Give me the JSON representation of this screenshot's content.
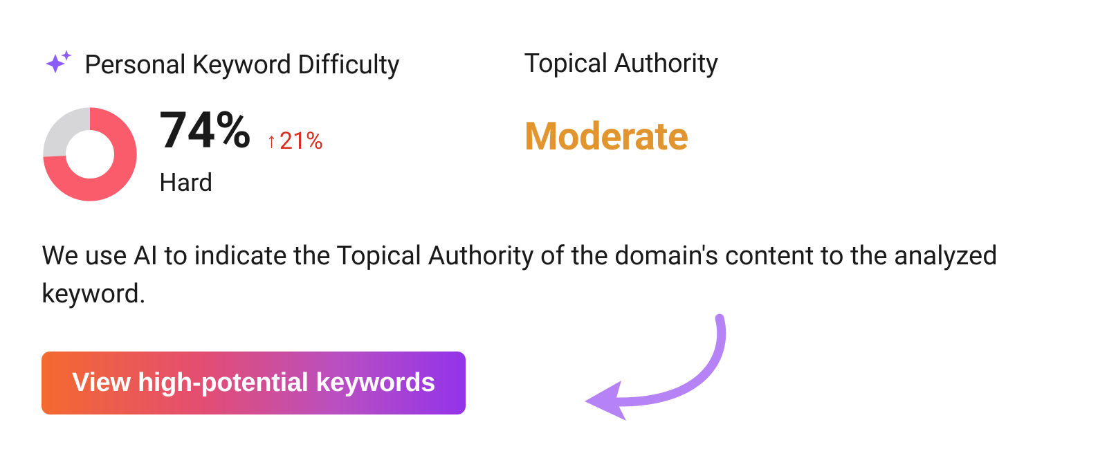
{
  "difficulty": {
    "title": "Personal Keyword Difficulty",
    "percent": "74%",
    "percent_value": 74,
    "delta": "21%",
    "delta_direction": "up",
    "label": "Hard"
  },
  "authority": {
    "title": "Topical Authority",
    "value": "Moderate"
  },
  "description": "We use AI to indicate the Topical Authority of the domain's content to the analyzed keyword.",
  "cta": {
    "label": "View high-potential keywords"
  },
  "colors": {
    "donut_fg": "#fb5c6c",
    "donut_bg": "#d6d6d9",
    "delta": "#d92d20",
    "authority": "#e2952e",
    "sparkle": "#8b5cf6",
    "arrow": "#b583f5"
  }
}
